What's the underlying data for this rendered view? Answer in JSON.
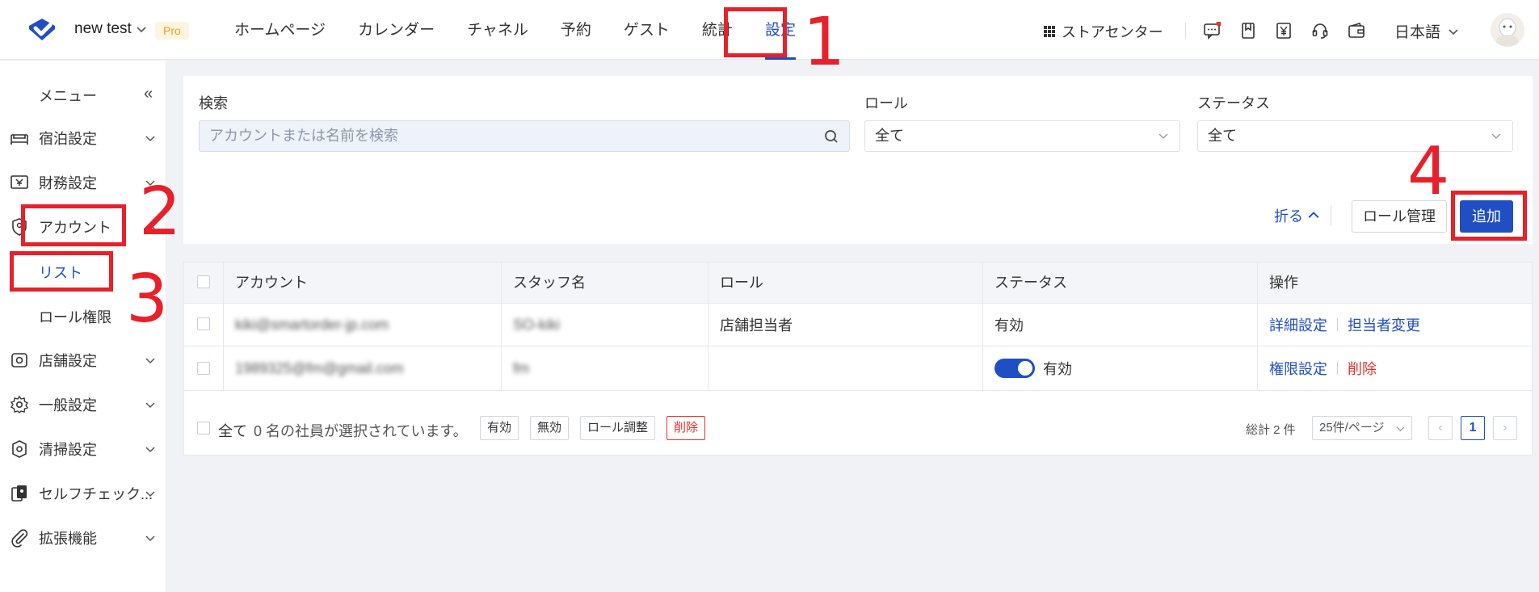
{
  "header": {
    "org_name": "new test",
    "plan_badge": "Pro",
    "nav": [
      {
        "label": "ホームページ"
      },
      {
        "label": "カレンダー"
      },
      {
        "label": "チャネル"
      },
      {
        "label": "予約"
      },
      {
        "label": "ゲスト"
      },
      {
        "label": "統計"
      },
      {
        "label": "設定",
        "active": true
      }
    ],
    "store_center": "ストアセンター",
    "language": "日本語"
  },
  "sidebar": {
    "menu_title": "メニュー",
    "items": [
      {
        "label": "宿泊設定",
        "icon": "bed-icon"
      },
      {
        "label": "財務設定",
        "icon": "finance-icon"
      },
      {
        "label": "アカウント",
        "icon": "account-shield-icon"
      },
      {
        "label": "店舗設定",
        "icon": "store-icon"
      },
      {
        "label": "一般設定",
        "icon": "gear-icon"
      },
      {
        "label": "清掃設定",
        "icon": "cleaning-icon"
      },
      {
        "label": "セルフチェック...",
        "icon": "self-checkin-icon"
      },
      {
        "label": "拡張機能",
        "icon": "paperclip-icon"
      }
    ],
    "account_sub": [
      {
        "label": "リスト",
        "active": true
      },
      {
        "label": "ロール権限"
      }
    ]
  },
  "filters": {
    "search_label": "検索",
    "search_placeholder": "アカウントまたは名前を検索",
    "role_label": "ロール",
    "role_value": "全て",
    "status_label": "ステータス",
    "status_value": "全て",
    "fold_label": "折る",
    "role_manage_button": "ロール管理",
    "add_button": "追加"
  },
  "table": {
    "columns": [
      "アカウント",
      "スタッフ名",
      "ロール",
      "ステータス",
      "操作"
    ],
    "rows": [
      {
        "account": "kiki@smartorder-jp.com",
        "staff": "SO-kiki",
        "role": "店舗担当者",
        "status": "有効",
        "actions": [
          "詳細設定",
          "担当者変更"
        ]
      },
      {
        "account": "1989325@fm@gmail.com",
        "staff": "fm",
        "role": "",
        "status": "有効",
        "actions": [
          "権限設定",
          "削除"
        ]
      }
    ],
    "footer": {
      "select_all": "全て",
      "selected_text": "0 名の社員が選択されています。",
      "bulk": [
        "有効",
        "無効",
        "ロール調整",
        "削除"
      ],
      "total": "総計 2 件",
      "page_size": "25件/ページ",
      "current_page": "1"
    }
  },
  "annotations": [
    "1",
    "2",
    "3",
    "4"
  ],
  "colors": {
    "accent": "#1f4fc2",
    "annotation": "#e8202a",
    "danger": "#e5322d"
  }
}
